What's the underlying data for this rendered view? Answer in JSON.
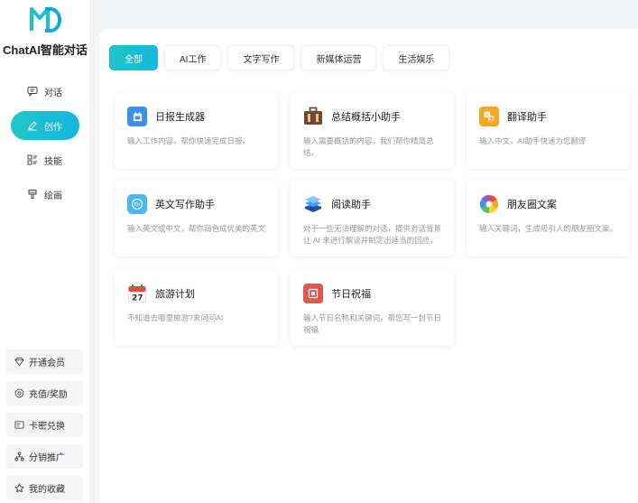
{
  "brand": {
    "name": "ChatAI智能对话"
  },
  "nav": {
    "items": [
      {
        "label": "对话",
        "icon": "chat-icon"
      },
      {
        "label": "创作",
        "icon": "pen-icon",
        "active": true
      },
      {
        "label": "技能",
        "icon": "skills-icon"
      },
      {
        "label": "绘画",
        "icon": "brush-icon"
      }
    ]
  },
  "bottom_menu": [
    {
      "label": "开通会员",
      "icon": "diamond-icon"
    },
    {
      "label": "充值/奖励",
      "icon": "coin-icon"
    },
    {
      "label": "卡密兑换",
      "icon": "card-icon"
    },
    {
      "label": "分销推广",
      "icon": "share-icon"
    },
    {
      "label": "我的收藏",
      "icon": "star-icon"
    }
  ],
  "tabs": [
    {
      "label": "全部",
      "active": true
    },
    {
      "label": "AI工作"
    },
    {
      "label": "文字写作"
    },
    {
      "label": "新媒体运营"
    },
    {
      "label": "生活娱乐"
    }
  ],
  "cards": [
    {
      "title": "日报生成器",
      "desc": "输入工作内容，帮你快速完成日报。",
      "icon": "calendar-doc-icon",
      "color": "#3b8ff0"
    },
    {
      "title": "总结概括小助手",
      "desc": "输入需要概括的内容，我们帮你精简总结。",
      "icon": "briefcase-icon",
      "color": "#6b4a3a"
    },
    {
      "title": "翻译助手",
      "desc": "输入中文，AI助手快速为您翻译",
      "icon": "translate-icon",
      "color": "#f5a623"
    },
    {
      "title": "英文写作助手",
      "desc": "输入英文或中文，帮你润色成优美的英文",
      "icon": "english-icon",
      "color": "#4ab8f0"
    },
    {
      "title": "阅读助手",
      "desc": "对于一些无法理解的对话，提供对话背景让 AI 来进行解读并制定出适当的回应。",
      "icon": "books-icon",
      "color": "#2f6fd6"
    },
    {
      "title": "朋友圈文案",
      "desc": "输入关键词，生成吸引人的朋友圈文案。",
      "icon": "aperture-icon",
      "color": "#e94b3c"
    },
    {
      "title": "旅游计划",
      "desc": "不知道去哪里旅游?来问问AI",
      "icon": "calendar-icon",
      "color": "#e84a3a"
    },
    {
      "title": "节日祝福",
      "desc": "输入节日名称和关键词，帮您写一封节日祝福",
      "icon": "gift-icon",
      "color": "#e2574c"
    }
  ],
  "calendar_day": "27"
}
